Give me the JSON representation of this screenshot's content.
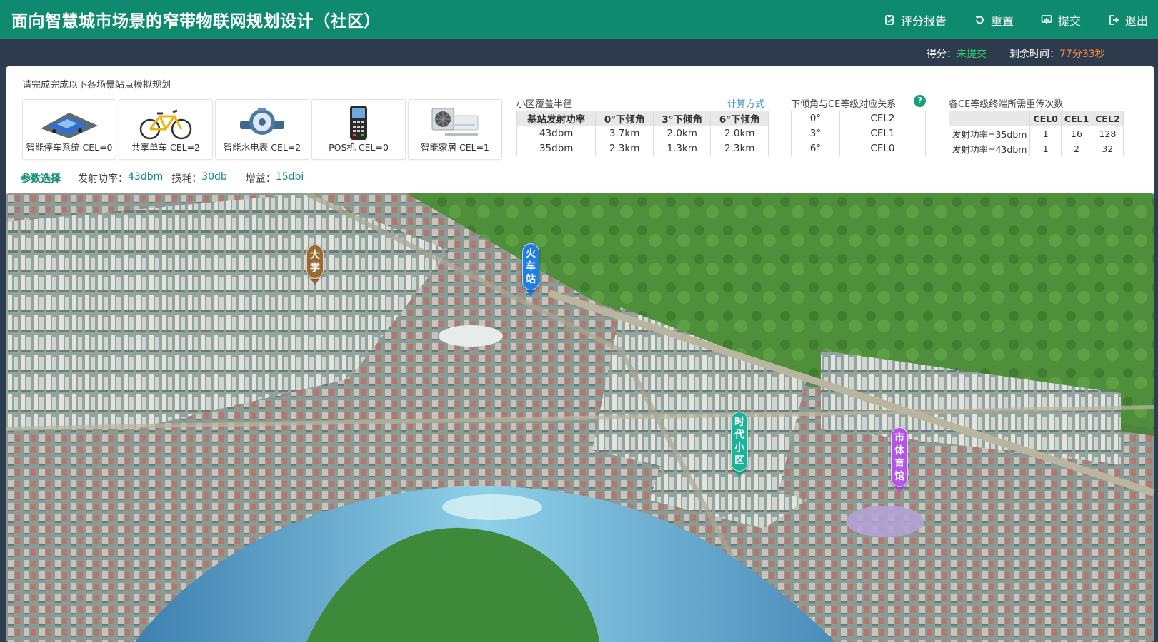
{
  "header": {
    "title": "面向智慧城市场景的窄带物联网规划设计（社区）",
    "nav": [
      {
        "label": "评分报告",
        "icon": "report-icon"
      },
      {
        "label": "重置",
        "icon": "reset-icon"
      },
      {
        "label": "提交",
        "icon": "submit-icon"
      },
      {
        "label": "退出",
        "icon": "exit-icon"
      }
    ]
  },
  "status": {
    "score_label": "得分：",
    "score_value": "未提交",
    "time_label": "剩余时间：",
    "time_value": "77分33秒"
  },
  "panel": {
    "hint": "请完成完成以下各场景站点模拟规划",
    "scenes": [
      {
        "label": "智能停车系统 CEL=0",
        "icon": "car-icon"
      },
      {
        "label": "共享单车 CEL=2",
        "icon": "bicycle-icon"
      },
      {
        "label": "智能水电表 CEL=2",
        "icon": "water-meter-icon"
      },
      {
        "label": "POS机 CEL=0",
        "icon": "pos-terminal-icon"
      },
      {
        "label": "智能家居 CEL=1",
        "icon": "air-conditioner-icon"
      }
    ]
  },
  "coverage": {
    "title": "小区覆盖半径",
    "calc_link": "计算方式",
    "headers": [
      "基站发射功率",
      "0°下倾角",
      "3°下倾角",
      "6°下倾角"
    ],
    "rows": [
      [
        "43dbm",
        "3.7km",
        "2.0km",
        "2.0km"
      ],
      [
        "35dbm",
        "2.3km",
        "1.3km",
        "2.3km"
      ]
    ]
  },
  "tilt": {
    "title": "下倾角与CE等级对应关系",
    "help": "?",
    "rows": [
      [
        "0°",
        "CEL2"
      ],
      [
        "3°",
        "CEL1"
      ],
      [
        "6°",
        "CEL0"
      ]
    ]
  },
  "repeat": {
    "title": "各CE等级终端所需重传次数",
    "headers": [
      "",
      "CEL0",
      "CEL1",
      "CEL2"
    ],
    "rows": [
      [
        "发射功率=35dbm",
        "1",
        "16",
        "128"
      ],
      [
        "发射功率=43dbm",
        "1",
        "2",
        "32"
      ]
    ]
  },
  "params": {
    "title": "参数选择",
    "power_label": "发射功率：",
    "power_value": "43dbm",
    "loss_label": "损耗：",
    "loss_value": "30db",
    "gain_label": "增益：",
    "gain_value": "15dbi"
  },
  "map": {
    "markers": [
      {
        "label": "大学",
        "color": "#9a6a35"
      },
      {
        "label": "火车站",
        "color": "#1e7ee8"
      },
      {
        "label": "时代小区",
        "color": "#1bb39a"
      },
      {
        "label": "市体育馆",
        "color": "#b455e6"
      }
    ]
  }
}
